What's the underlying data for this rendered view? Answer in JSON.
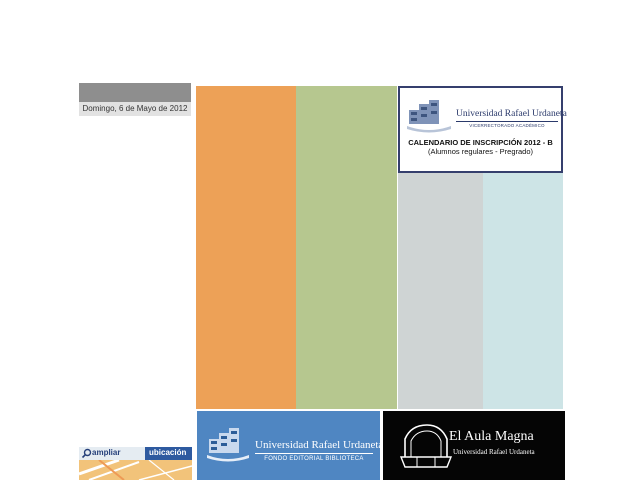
{
  "sidebar": {
    "date": "Domingo, 6 de Mayo de 2012"
  },
  "tiles": {
    "colors": [
      "#eda157",
      "#b6c78f",
      "#cfd4d4",
      "#cde4e6"
    ]
  },
  "calendar_card": {
    "university_name": "Universidad Rafael Urdaneta",
    "department": "VICERRECTORADO ACADÉMICO",
    "title": "CALENDARIO  DE INSCRIPCIÓN 2012 - B",
    "subtitle": "(Alumnos regulares - Pregrado)"
  },
  "map_banner": {
    "left_label": "ampliar",
    "right_label": "ubicación",
    "icon": "search-icon"
  },
  "fondo_banner": {
    "university_name": "Universidad Rafael Urdaneta",
    "subtitle": "FONDO EDITORIAL BIBLIOTECA"
  },
  "aula_banner": {
    "title": "El Aula Magna",
    "subtitle": "Universidad Rafael Urdaneta"
  }
}
